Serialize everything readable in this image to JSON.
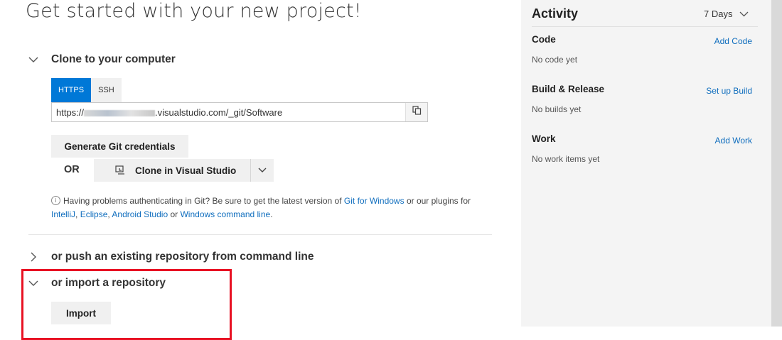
{
  "main": {
    "title": "Get started with your new project!",
    "clone_section": {
      "label": "Clone to your computer",
      "tabs": [
        "HTTPS",
        "SSH"
      ],
      "url_prefix": "https://",
      "url_suffix": ".visualstudio.com/_git/Software",
      "generate_credentials": "Generate Git credentials",
      "or": "OR",
      "clone_in_vs": "Clone in Visual Studio",
      "help_text_1": "Having problems authenticating in Git? Be sure to get the latest version of",
      "help_link_git_windows": "Git for Windows",
      "help_text_2": "or our plugins for",
      "help_link_intellij": "IntelliJ",
      "help_link_eclipse": "Eclipse",
      "help_link_android": "Android Studio",
      "help_text_3": "or",
      "help_link_cmdline": "Windows command line",
      "help_text_end": "."
    },
    "push_section": {
      "label": "or push an existing repository from command line"
    },
    "import_section": {
      "label": "or import a repository",
      "button": "Import"
    }
  },
  "activity": {
    "title": "Activity",
    "range": "7 Days",
    "groups": [
      {
        "heading": "Code",
        "link": "Add Code",
        "empty": "No code yet"
      },
      {
        "heading": "Build & Release",
        "link": "Set up Build",
        "empty": "No builds yet"
      },
      {
        "heading": "Work",
        "link": "Add Work",
        "empty": "No work items yet"
      }
    ]
  },
  "colors": {
    "accent": "#0078d7",
    "link": "#106ebe",
    "highlight": "#e81123"
  }
}
